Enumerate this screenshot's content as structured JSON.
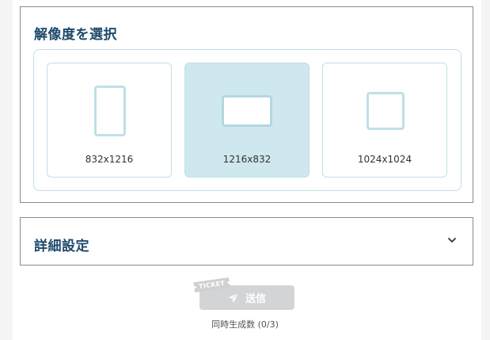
{
  "resolution": {
    "title": "解像度を選択",
    "options": [
      {
        "label": "832x1216",
        "orientation": "portrait",
        "selected": false
      },
      {
        "label": "1216x832",
        "orientation": "landscape",
        "selected": true
      },
      {
        "label": "1024x1024",
        "orientation": "square",
        "selected": false
      }
    ]
  },
  "advanced": {
    "title": "詳細設定",
    "icon": "chevron-down-icon"
  },
  "submit": {
    "ticket_label": "TICKET",
    "label": "送信",
    "icon": "send-icon",
    "disabled": true
  },
  "generation_count": "同時生成数 (0/3)",
  "colors": {
    "heading": "#1d4a6b",
    "accent_border": "#bfe0e7",
    "selected_bg": "#cfe7ee",
    "disabled_button": "#d3d4d6"
  }
}
